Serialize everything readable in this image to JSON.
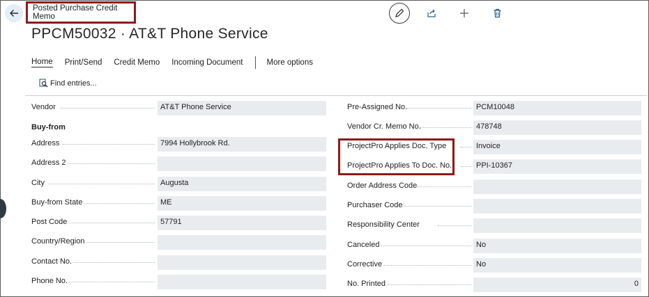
{
  "page": {
    "caption": "Posted Purchase Credit Memo",
    "title": "PPCM50032 · AT&T Phone Service"
  },
  "actions": {
    "icons": [
      "edit-icon",
      "share-icon",
      "add-icon",
      "delete-icon"
    ]
  },
  "menu": {
    "items": [
      "Home",
      "Print/Send",
      "Credit Memo",
      "Incoming Document"
    ],
    "more": "More options"
  },
  "find": {
    "label": "Find entries..."
  },
  "left": {
    "vendor": {
      "label": "Vendor",
      "value": "AT&T Phone Service"
    },
    "section": "Buy-from",
    "address": {
      "label": "Address",
      "value": "7994 Hollybrook Rd."
    },
    "address2": {
      "label": "Address 2",
      "value": ""
    },
    "city": {
      "label": "City",
      "value": "Augusta"
    },
    "state": {
      "label": "Buy-from State",
      "value": "ME"
    },
    "post_code": {
      "label": "Post Code",
      "value": "57791"
    },
    "country": {
      "label": "Country/Region",
      "value": ""
    },
    "contact": {
      "label": "Contact No.",
      "value": ""
    },
    "phone": {
      "label": "Phone No.",
      "value": ""
    }
  },
  "right": {
    "pre_assigned": {
      "label": "Pre-Assigned No.",
      "value": "PCM10048"
    },
    "vendor_cr": {
      "label": "Vendor Cr. Memo No.",
      "value": "478748"
    },
    "applies_type": {
      "label": "ProjectPro Applies Doc. Type",
      "value": "Invoice"
    },
    "applies_no": {
      "label": "ProjectPro Applies To Doc. No.",
      "value": "PPI-10367"
    },
    "order_addr": {
      "label": "Order Address Code",
      "value": ""
    },
    "purchaser": {
      "label": "Purchaser Code",
      "value": ""
    },
    "resp_center": {
      "label": "Responsibility Center",
      "value": ""
    },
    "canceled": {
      "label": "Canceled",
      "value": "No"
    },
    "corrective": {
      "label": "Corrective",
      "value": "No"
    },
    "no_printed": {
      "label": "No. Printed",
      "value": "0"
    }
  }
}
